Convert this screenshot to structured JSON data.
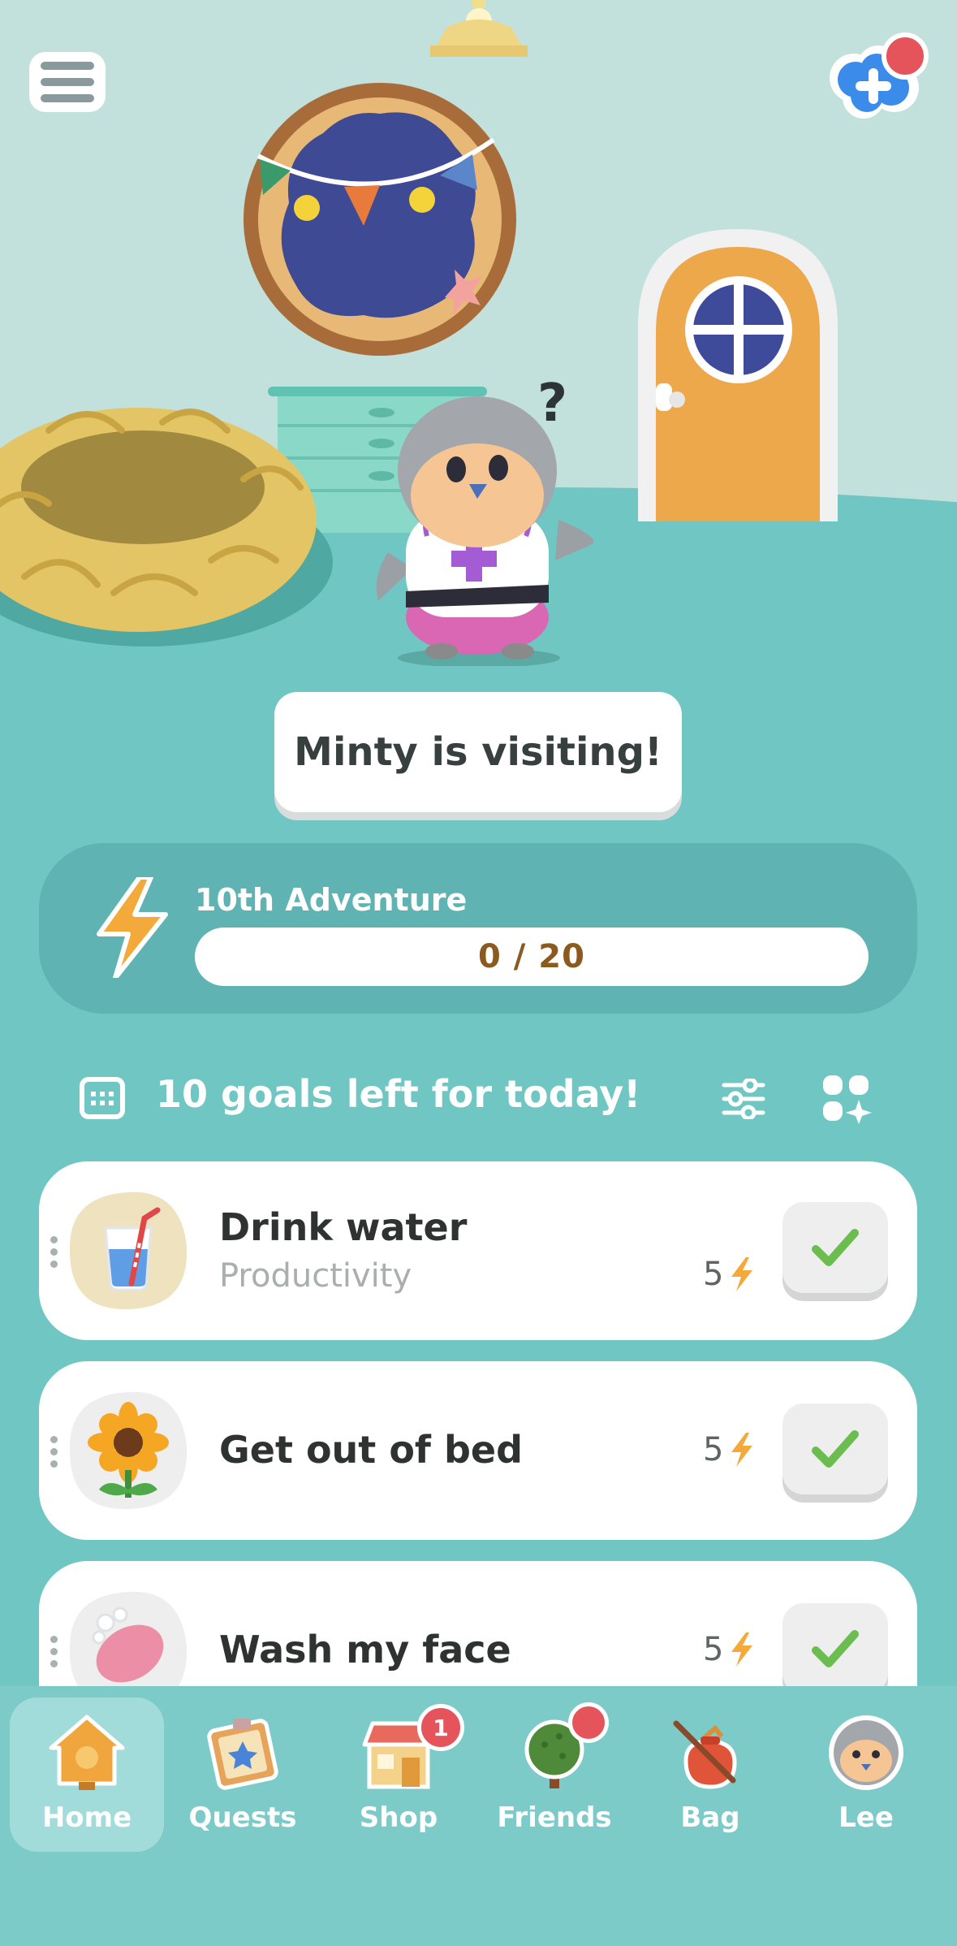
{
  "scene": {
    "question_mark": "?",
    "visiting_message": "Minty is visiting!"
  },
  "adventure": {
    "label": "10th Adventure",
    "progress_text": "0 / 20",
    "progress_fraction": 0
  },
  "goals": {
    "header": "10 goals left for today!",
    "items": [
      {
        "title": "Drink water",
        "category": "Productivity",
        "points": "5",
        "icon": "water-glass-icon"
      },
      {
        "title": "Get out of bed",
        "category": "",
        "points": "5",
        "icon": "sunflower-icon"
      },
      {
        "title": "Wash my face",
        "category": "",
        "points": "5",
        "icon": "soap-icon"
      }
    ]
  },
  "notifications": {
    "shop_badge": "1"
  },
  "tabs": [
    {
      "label": "Home",
      "icon": "house-icon",
      "active": true
    },
    {
      "label": "Quests",
      "icon": "quest-board-icon"
    },
    {
      "label": "Shop",
      "icon": "shop-icon"
    },
    {
      "label": "Friends",
      "icon": "tree-icon"
    },
    {
      "label": "Bag",
      "icon": "bag-icon"
    },
    {
      "label": "Lee",
      "icon": "avatar-icon"
    }
  ],
  "colors": {
    "background": "#6fc6c2",
    "accent_energy": "#f4a93b",
    "check_green": "#6cbd4f",
    "notification_red": "#e6545b"
  }
}
